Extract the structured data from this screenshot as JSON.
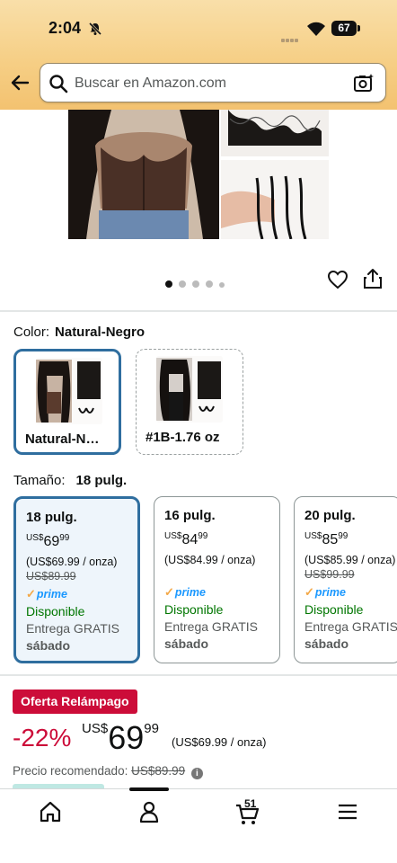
{
  "status_bar": {
    "time": "2:04",
    "battery": "67"
  },
  "header": {
    "search_placeholder": "Buscar en Amazon.com"
  },
  "gallery": {
    "dot_count": 5,
    "active_dot": 0
  },
  "color": {
    "label": "Color:",
    "selected": "Natural-Negro",
    "options": [
      {
        "label": "Natural-N…",
        "selected": true
      },
      {
        "label": "#1B-1.76 oz",
        "selected": false
      }
    ]
  },
  "size": {
    "label": "Tamaño:",
    "selected": "18 pulg.",
    "options": [
      {
        "name": "18 pulg.",
        "currency": "US$",
        "whole": "69",
        "fraction": "99",
        "unit_price": "(US$69.99 / onza)",
        "was": "US$89.99",
        "prime": "prime",
        "availability": "Disponible",
        "delivery": "Entrega GRATIS",
        "day": "sábado",
        "selected": true
      },
      {
        "name": "16 pulg.",
        "currency": "US$",
        "whole": "84",
        "fraction": "99",
        "unit_price": "(US$84.99 / onza)",
        "was": "",
        "prime": "prime",
        "availability": "Disponible",
        "delivery": "Entrega GRATIS",
        "day": "sábado",
        "selected": false
      },
      {
        "name": "20 pulg.",
        "currency": "US$",
        "whole": "85",
        "fraction": "99",
        "unit_price": "(US$85.99 / onza)",
        "was": "US$99.99",
        "prime": "prime",
        "availability": "Disponible",
        "delivery": "Entrega GRATIS",
        "day": "sábado",
        "selected": false
      }
    ]
  },
  "deal": {
    "badge": "Oferta Relámpago",
    "discount": "-22%",
    "currency": "US$",
    "whole": "69",
    "fraction": "99",
    "unit_price": "(US$69.99 / onza)",
    "recommended_label": "Precio recomendado:",
    "recommended_price": "US$89.99"
  },
  "bottom_nav": {
    "cart_count": "51",
    "items": [
      "home-icon",
      "account-icon",
      "cart-icon",
      "menu-icon"
    ]
  },
  "colors": {
    "accent_blue": "#2f6e9f",
    "deal_red": "#cc0c39",
    "available_green": "#007600",
    "prime_blue": "#1a98ff",
    "header_gold": "#f6cf86"
  }
}
